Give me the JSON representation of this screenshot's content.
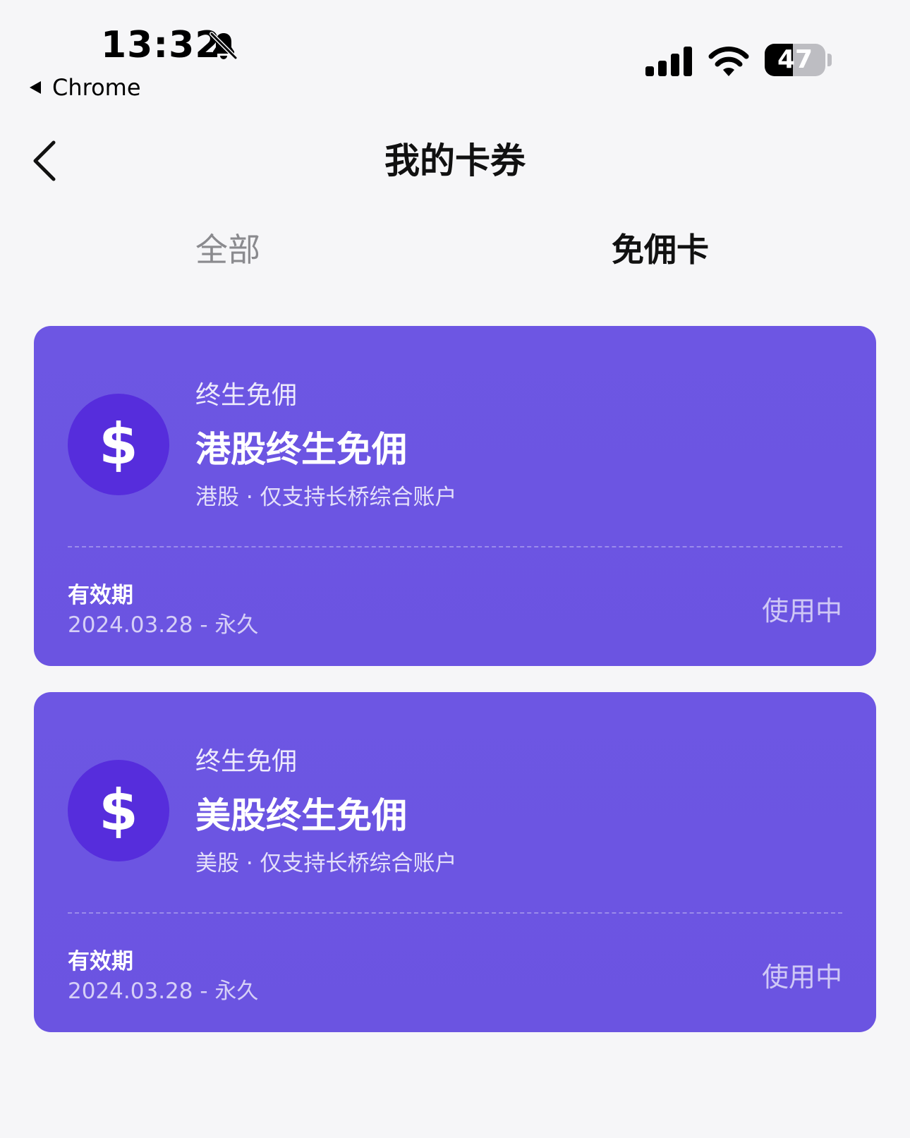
{
  "status_bar": {
    "time": "13:32",
    "back_app": "Chrome",
    "battery_level": "47",
    "battery_fraction": 0.47
  },
  "nav": {
    "title": "我的卡券"
  },
  "tabs": [
    {
      "label": "全部",
      "active": false
    },
    {
      "label": "免佣卡",
      "active": true
    }
  ],
  "cards": [
    {
      "icon": "dollar-icon",
      "icon_glyph": "$",
      "kicker": "终生免佣",
      "title": "港股终生免佣",
      "description": "港股 · 仅支持长桥综合账户",
      "validity_label": "有效期",
      "validity_range": "2024.03.28 - 永久",
      "status": "使用中"
    },
    {
      "icon": "dollar-icon",
      "icon_glyph": "$",
      "kicker": "终生免佣",
      "title": "美股终生免佣",
      "description": "美股 · 仅支持长桥综合账户",
      "validity_label": "有效期",
      "validity_range": "2024.03.28 - 永久",
      "status": "使用中"
    }
  ],
  "colors": {
    "background": "#f6f6f8",
    "card": "#6c55e2",
    "coin": "#562ddc",
    "tab_inactive": "#8a8a8e"
  }
}
